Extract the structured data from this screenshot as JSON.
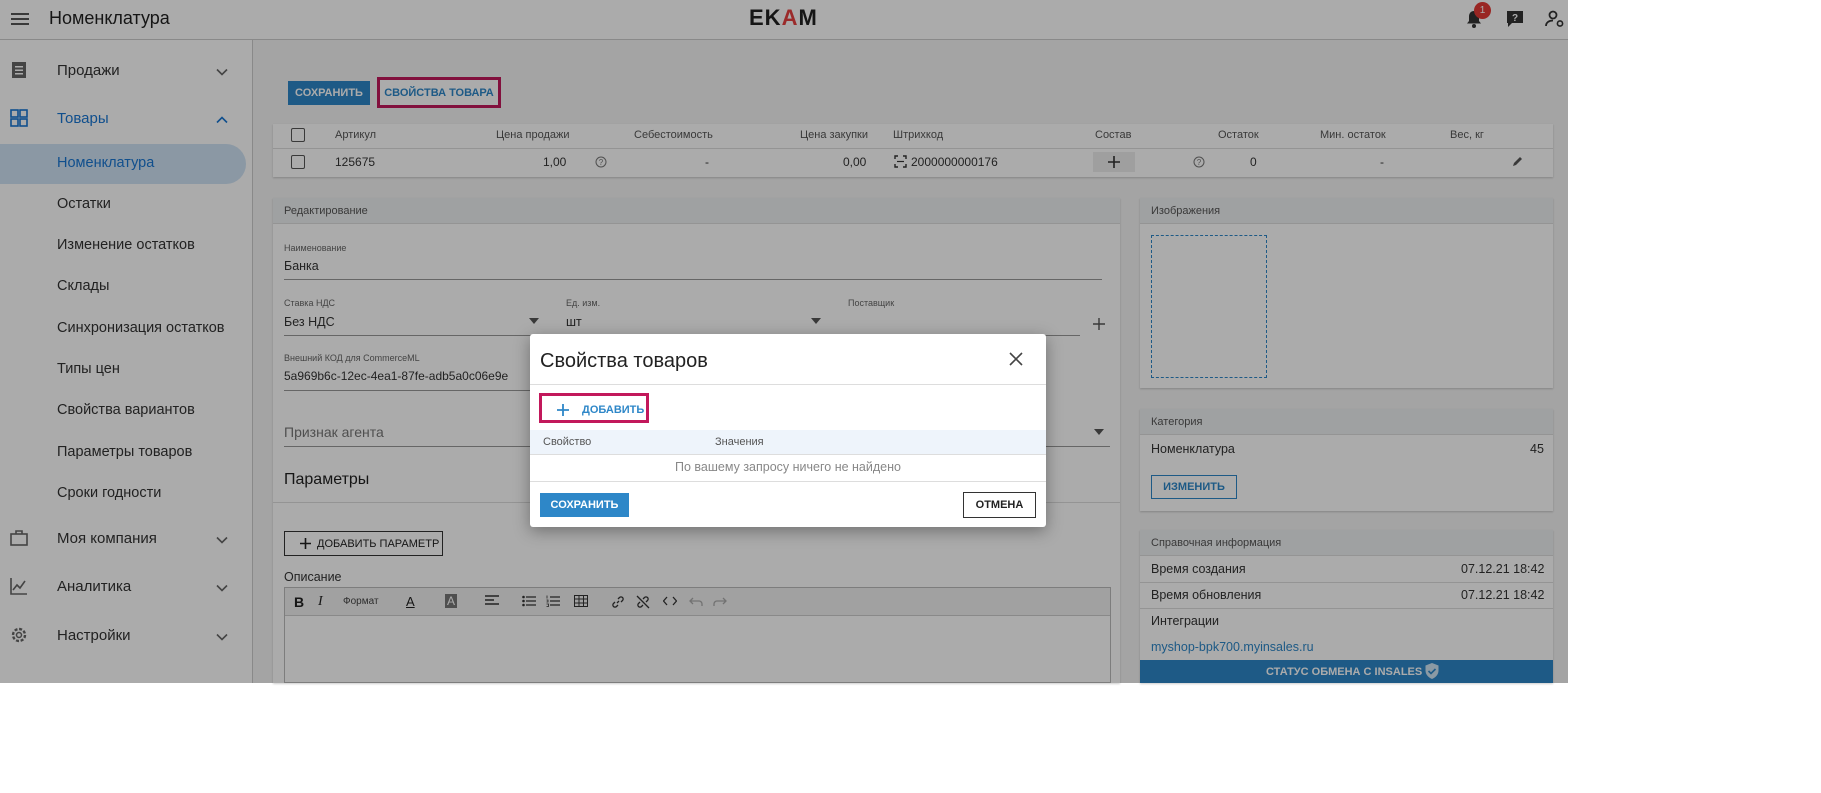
{
  "header": {
    "title": "Номенклатура",
    "logo": {
      "left": "EK",
      "v": "A",
      "right": "M"
    },
    "notifications_count": "1"
  },
  "sidebar": {
    "sales": "Продажи",
    "goods": "Товары",
    "goods_items": [
      "Номенклатура",
      "Остатки",
      "Изменение остатков",
      "Склады",
      "Синхронизация остатков",
      "Типы цен",
      "Свойства вариантов",
      "Параметры товаров",
      "Сроки годности"
    ],
    "company": "Моя компания",
    "analytics": "Аналитика",
    "settings": "Настройки"
  },
  "toolbar": {
    "save": "СОХРАНИТЬ",
    "props": "СВОЙСТВА ТОВАРА"
  },
  "product_table": {
    "headers": [
      "Артикул",
      "Цена продажи",
      "Себестоимость",
      "Цена закупки",
      "Штрихкод",
      "Состав",
      "Остаток",
      "Мин. остаток",
      "Вес, кг"
    ],
    "row": {
      "sku": "125675",
      "price": "1,00",
      "cost": "-",
      "purchase": "0,00",
      "barcode": "2000000000176",
      "stock": "0",
      "min_stock": "-"
    }
  },
  "editing": {
    "header": "Редактирование",
    "name_label": "Наименование",
    "name_value": "Банка",
    "vat_label": "Ставка НДС",
    "vat_value": "Без НДС",
    "unit_label": "Ед. изм.",
    "unit_value": "шт",
    "supplier_label": "Поставщик",
    "ext_code_label": "Внешний КОД для CommerceML",
    "ext_code_value": "5a969b6c-12ec-4ea1-87fe-adb5a0c06e9e",
    "agent_placeholder": "Признак агента",
    "params_title": "Параметры",
    "add_param": "ДОБАВИТЬ ПАРАМЕТР",
    "description_label": "Описание",
    "format_label": "Формат"
  },
  "images_card": {
    "header": "Изображения"
  },
  "category_card": {
    "header": "Категория",
    "name": "Номенклатура",
    "count": "45",
    "change": "ИЗМЕНИТЬ"
  },
  "info_card": {
    "header": "Справочная информация",
    "created_label": "Время создания",
    "created_value": "07.12.21 18:42",
    "updated_label": "Время обновления",
    "updated_value": "07.12.21 18:42",
    "integrations_label": "Интеграции",
    "integration_link": "myshop-bpk700.myinsales.ru",
    "exchange_status": "СТАТУС ОБМЕНА С INSALES"
  },
  "modal": {
    "title": "Свойства товаров",
    "add": "ДОБАВИТЬ",
    "col_property": "Свойство",
    "col_values": "Значения",
    "empty": "По вашему запросу ничего не найдено",
    "save": "СОХРАНИТЬ",
    "cancel": "ОТМЕНА"
  },
  "colors": {
    "accent": "#2e87c8",
    "highlight": "#c2185b",
    "badge": "#e53935"
  }
}
